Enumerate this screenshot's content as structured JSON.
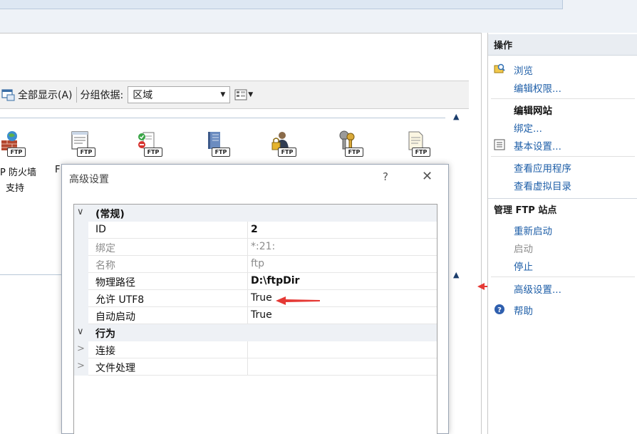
{
  "toolbar": {
    "show_all_label": "全部显示(A)",
    "group_by_label": "分组依据:",
    "group_by_value": "区域"
  },
  "features": {
    "firewall_label_line1": "P 防火墙",
    "firewall_label_line2": "支持",
    "partial_label": "F",
    "badge": "FTP"
  },
  "actions": {
    "header": "操作",
    "browse": "浏览",
    "edit_permissions": "编辑权限...",
    "edit_site": "编辑网站",
    "bindings": "绑定...",
    "basic_settings": "基本设置...",
    "view_apps": "查看应用程序",
    "view_vdirs": "查看虚拟目录",
    "manage_header": "管理 FTP 站点",
    "restart": "重新启动",
    "start": "启动",
    "stop": "停止",
    "advanced_settings": "高级设置...",
    "help": "帮助"
  },
  "dialog": {
    "title": "高级设置",
    "help_glyph": "?",
    "close_glyph": "✕",
    "rows": [
      {
        "type": "category",
        "expander": "∨",
        "name": "(常规)",
        "value": ""
      },
      {
        "type": "prop",
        "name": "ID",
        "value": "2",
        "bold": true
      },
      {
        "type": "prop",
        "name": "绑定",
        "value": "*:21:",
        "dim": true
      },
      {
        "type": "prop",
        "name": "名称",
        "value": "ftp",
        "dim": true
      },
      {
        "type": "prop",
        "name": "物理路径",
        "value": "D:\\ftpDir",
        "bold": true
      },
      {
        "type": "prop",
        "name": "允许 UTF8",
        "value": "True"
      },
      {
        "type": "prop",
        "name": "自动启动",
        "value": "True"
      },
      {
        "type": "category",
        "expander": "∨",
        "name": "行为",
        "value": ""
      },
      {
        "type": "sub",
        "expander": ">",
        "name": "连接",
        "value": ""
      },
      {
        "type": "sub",
        "expander": ">",
        "name": "文件处理",
        "value": ""
      }
    ]
  },
  "colors": {
    "link": "#1f5fa8",
    "annotation_arrow": "#e53935"
  }
}
